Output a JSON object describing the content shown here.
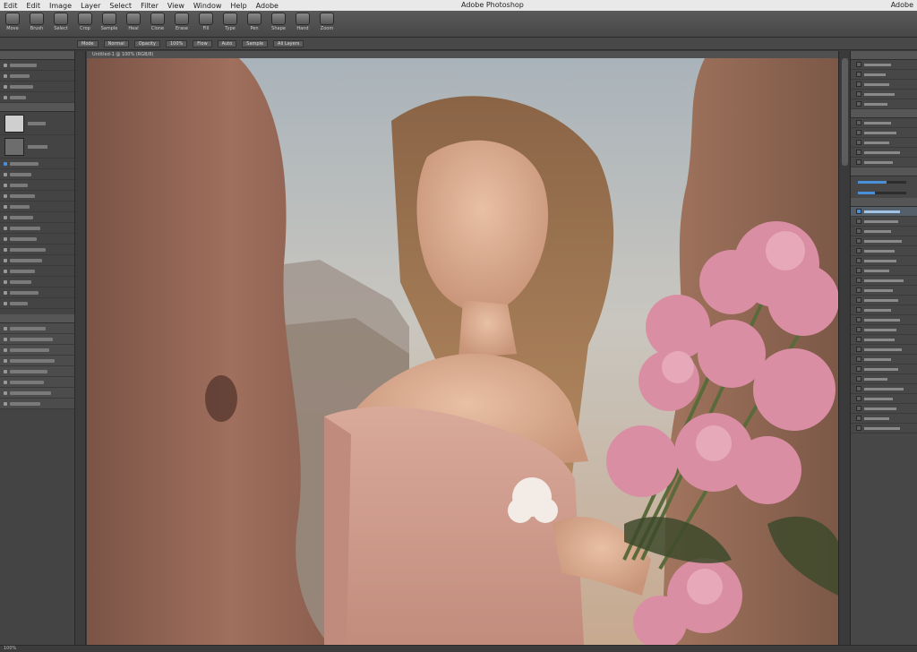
{
  "menubar": {
    "items": [
      "Edit",
      "Edit",
      "Image",
      "Layer",
      "Select",
      "Filter",
      "View",
      "Window",
      "Help",
      "Adobe"
    ],
    "window_title": "Adobe Photoshop",
    "right_label": "Adobe"
  },
  "toolbar": {
    "tools": [
      {
        "icon": "move-tool-icon",
        "label": "Move"
      },
      {
        "icon": "brush-tool-icon",
        "label": "Brush"
      },
      {
        "icon": "marquee-tool-icon",
        "label": "Select"
      },
      {
        "icon": "crop-tool-icon",
        "label": "Crop"
      },
      {
        "icon": "eyedropper-tool-icon",
        "label": "Sample"
      },
      {
        "icon": "healing-tool-icon",
        "label": "Heal"
      },
      {
        "icon": "clone-tool-icon",
        "label": "Clone"
      },
      {
        "icon": "eraser-tool-icon",
        "label": "Erase"
      },
      {
        "icon": "gradient-tool-icon",
        "label": "Fill"
      },
      {
        "icon": "text-tool-icon",
        "label": "Type"
      },
      {
        "icon": "pen-tool-icon",
        "label": "Pen"
      },
      {
        "icon": "shape-tool-icon",
        "label": "Shape"
      },
      {
        "icon": "hand-tool-icon",
        "label": "Hand"
      },
      {
        "icon": "zoom-tool-icon",
        "label": "Zoom"
      }
    ]
  },
  "optionsbar": {
    "chips": [
      "Mode",
      "Normal",
      "Opacity",
      "100%",
      "Flow",
      "Auto",
      "Sample",
      "All Layers"
    ]
  },
  "canvas": {
    "tab_label": "Untitled-1 @ 100% (RGB/8)"
  },
  "statusbar": {
    "text": "100%"
  },
  "colors": {
    "accent": "#4a90d9",
    "panel_bg": "#444444",
    "menubar_bg": "#e9e9e9"
  }
}
